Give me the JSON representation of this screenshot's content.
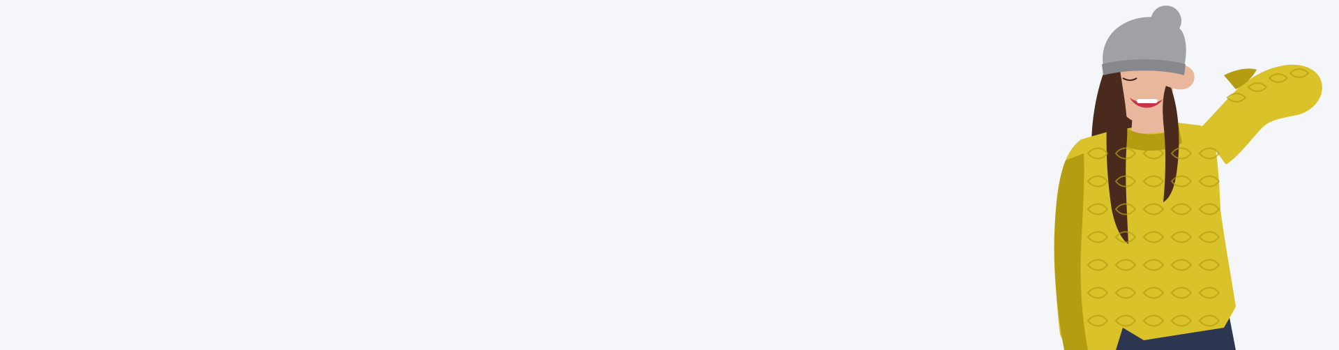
{
  "banner": {
    "background_color": "#f5f6fa",
    "image": {
      "subject": "woman-in-yellow-sweater-and-grey-beanie",
      "colors": {
        "sweater": "#d9c22a",
        "sweater_shadow": "#b59d12",
        "sweater_highlight": "#ead64a",
        "beanie": "#9fa1a4",
        "beanie_shadow": "#86888b",
        "skin": "#e9b79c",
        "hair": "#4a2a1c",
        "lips": "#c8324a",
        "jeans": "#2c3650"
      }
    }
  }
}
